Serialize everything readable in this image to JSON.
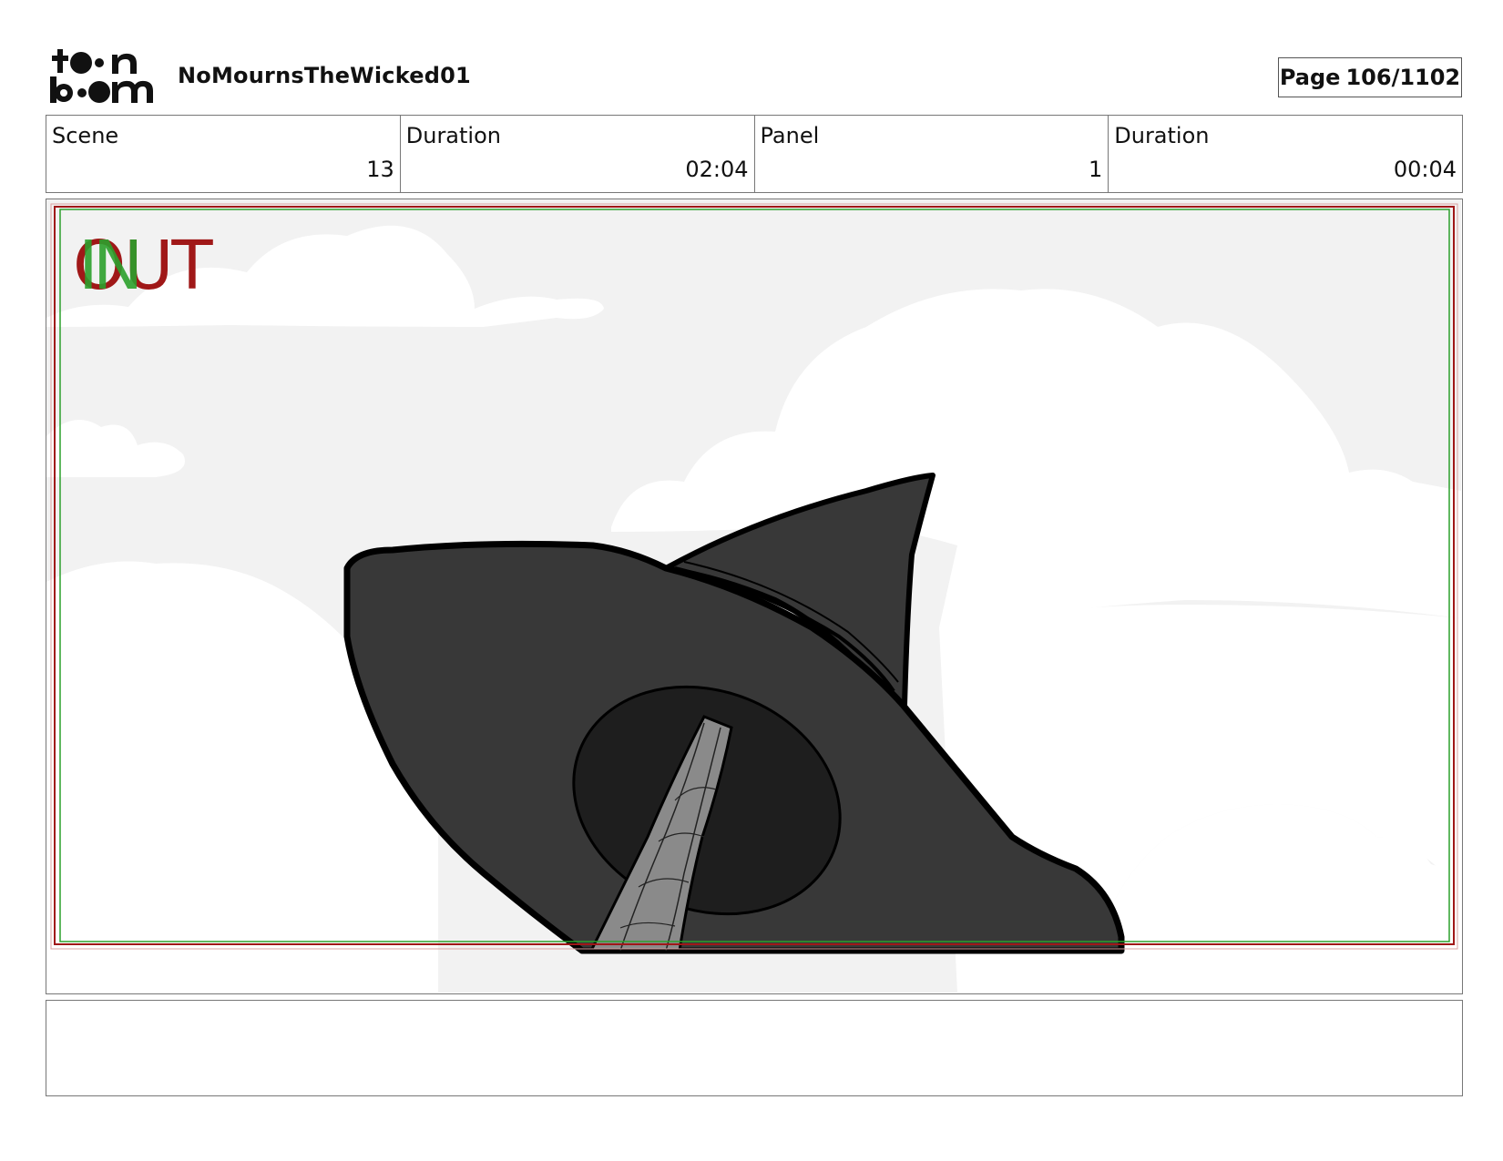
{
  "header": {
    "logo_text": "toon boom",
    "project_title": "NoMournsTheWicked01",
    "page_label": "Page",
    "page_number": "106/1102"
  },
  "info": {
    "scene_label": "Scene",
    "scene_value": "13",
    "scene_duration_label": "Duration",
    "scene_duration_value": "02:04",
    "panel_label": "Panel",
    "panel_value": "1",
    "panel_duration_label": "Duration",
    "panel_duration_value": "00:04"
  },
  "panel": {
    "out_label": "OUT",
    "in_label": "IN",
    "out_color": "#a01818",
    "in_color": "#2ca02c",
    "description": ""
  },
  "notes": {
    "text": ""
  }
}
